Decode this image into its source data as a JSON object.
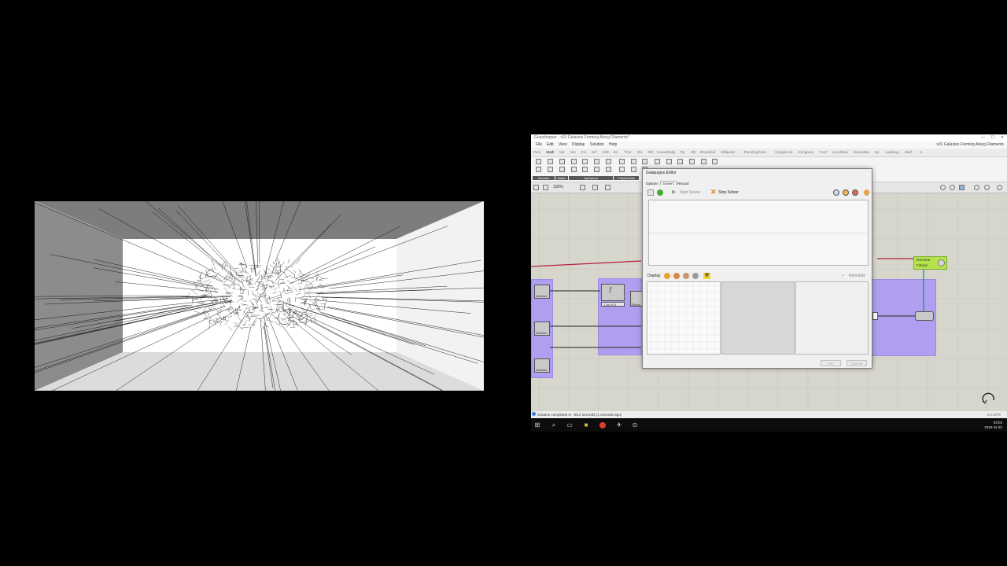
{
  "window": {
    "title": "Grasshopper - v01 Galaxies Forming Along Filaments*",
    "document_name": "v01 Galaxies Forming Along Filaments",
    "controls": [
      "—",
      "☐",
      "✕"
    ]
  },
  "menu": [
    "File",
    "Edit",
    "View",
    "Display",
    "Solution",
    "Help"
  ],
  "tabs": [
    "Para",
    "Math",
    "Set",
    "Vec",
    "Crv",
    "Srf",
    "Msh",
    "Int",
    "Trns",
    "Dis",
    "Wb",
    "GooseBaby",
    "Fly",
    "Mk",
    "Showdeal",
    "Millipede",
    "PanelingTools",
    "Kangaroo2",
    "Kangaroo",
    "Fox7",
    "LunchBox",
    "Honeybee",
    "Ivy",
    "Ladybug",
    "Starf",
    "H"
  ],
  "active_tab": "Math",
  "ribbon_groups": [
    "Domain",
    "Matrix",
    "Operators",
    "Polynomials"
  ],
  "canvas": {
    "zoom": "100%",
    "genome_node": {
      "line1": "Genome",
      "line2": "Fitness"
    },
    "slider_value": "1.5e-004",
    "param_labels": [
      "Number",
      "Number",
      "Number"
    ],
    "node_label": "Elbow"
  },
  "status": {
    "text": "Solution completed in ~25.0 seconds (1 seconds ago)",
    "version": "0.9.0076"
  },
  "clock": {
    "time": "04:02",
    "date": "2016-11-22"
  },
  "taskbar_icons": [
    "windows-start-icon",
    "search-icon",
    "task-view-icon",
    "file-explorer-icon",
    "chrome-icon",
    "grasshopper-icon",
    "settings-icon"
  ],
  "galapagos": {
    "title": "Galapagos Editor",
    "tabs": [
      "Options",
      "Solvers",
      "Record"
    ],
    "active_tab": "Solvers",
    "start_solver": "Start Solver",
    "stop_solver": "Stop Solver",
    "display_label": "Display",
    "reinstate": "Reinstate",
    "ok": "OK",
    "cancel": "Cancel"
  },
  "colors": {
    "purple_group": "#b09ef0",
    "genome_node": "#b5e34b",
    "wire_red": "#b41e3c",
    "stop_icon": "#e07b1a"
  }
}
